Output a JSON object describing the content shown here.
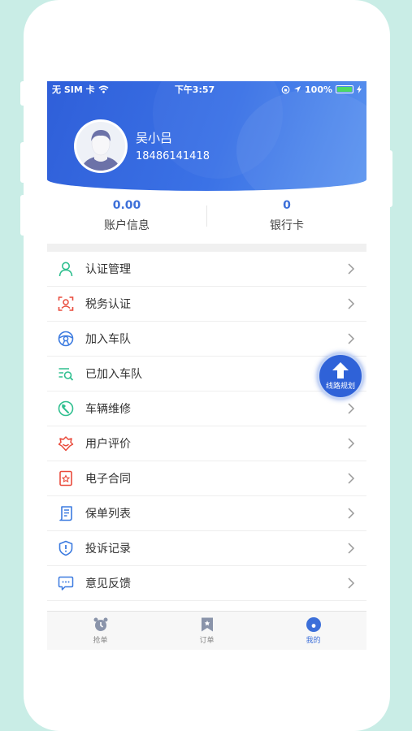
{
  "status_bar": {
    "carrier": "无 SIM 卡",
    "time": "下午3:57",
    "battery": "100%"
  },
  "profile": {
    "name": "吴小吕",
    "phone": "18486141418"
  },
  "stats": [
    {
      "value": "0.00",
      "label": "账户信息"
    },
    {
      "value": "0",
      "label": "银行卡"
    }
  ],
  "menu": [
    {
      "label": "认证管理",
      "icon": "person-icon",
      "color": "#2fbf8f"
    },
    {
      "label": "税务认证",
      "icon": "face-scan-icon",
      "color": "#e94b3c"
    },
    {
      "label": "加入车队",
      "icon": "steering-wheel-icon",
      "color": "#3c7be0"
    },
    {
      "label": "已加入车队",
      "icon": "list-search-icon",
      "color": "#2fbf8f"
    },
    {
      "label": "车辆维修",
      "icon": "wrench-icon",
      "color": "#2fbf8f"
    },
    {
      "label": "用户评价",
      "icon": "badge-icon",
      "color": "#e94b3c"
    },
    {
      "label": "电子合同",
      "icon": "contract-icon",
      "color": "#e94b3c"
    },
    {
      "label": "保单列表",
      "icon": "scroll-icon",
      "color": "#3c7be0"
    },
    {
      "label": "投诉记录",
      "icon": "shield-icon",
      "color": "#3c7be0"
    },
    {
      "label": "意见反馈",
      "icon": "chat-icon",
      "color": "#3c7be0"
    }
  ],
  "float_button": {
    "label": "线路规划",
    "icon": "arrow-up-icon"
  },
  "tabs": [
    {
      "label": "抢单",
      "icon": "alarm-clock-icon",
      "active": false
    },
    {
      "label": "订单",
      "icon": "bookmark-icon",
      "active": false
    },
    {
      "label": "我的",
      "icon": "profile-circle-icon",
      "active": true
    }
  ],
  "colors": {
    "accent": "#3c6fd9",
    "header": "#3b72e6",
    "background": "#c9ede6"
  }
}
